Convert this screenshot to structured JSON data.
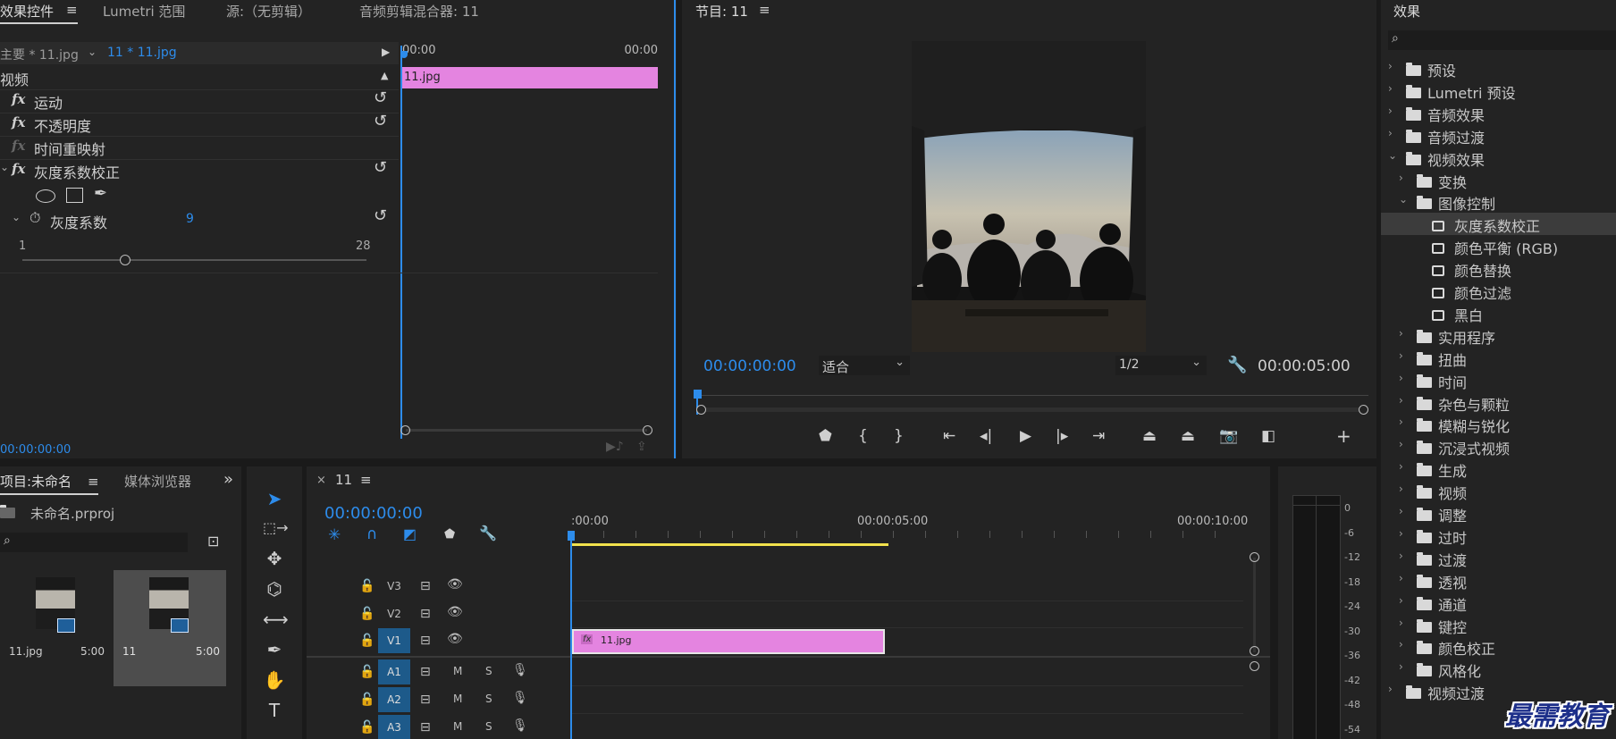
{
  "effect_controls": {
    "tabs": [
      "效果控件",
      "Lumetri 范围",
      "源:（无剪辑）",
      "音频剪辑混合器: 11"
    ],
    "menu_glyph": "≡",
    "master_clip": "主要 * 11.jpg",
    "sequence_clip": "11 * 11.jpg",
    "ruler_start": "00:00",
    "ruler_end": "00:00",
    "clip_name": "11.jpg",
    "section": "视频",
    "effects": [
      {
        "name": "运动"
      },
      {
        "name": "不透明度"
      },
      {
        "name": "时间重映射"
      },
      {
        "name": "灰度系数校正"
      }
    ],
    "param_name": "灰度系数",
    "param_value": "9",
    "slider_min": "1",
    "slider_max": "28",
    "slider_value": 9,
    "timecode": "00:00:00:00"
  },
  "program": {
    "title": "节目: 11",
    "timecode_left": "00:00:00:00",
    "fit": "适合",
    "resolution": "1/2",
    "timecode_right": "00:00:05:00"
  },
  "effects_panel": {
    "title": "效果",
    "items": [
      {
        "label": "预设",
        "icon": "folder-star",
        "indent": 0,
        "open": false
      },
      {
        "label": "Lumetri 预设",
        "icon": "folder-star",
        "indent": 0,
        "open": false
      },
      {
        "label": "音频效果",
        "icon": "folder",
        "indent": 0,
        "open": false
      },
      {
        "label": "音频过渡",
        "icon": "folder",
        "indent": 0,
        "open": false
      },
      {
        "label": "视频效果",
        "icon": "folder",
        "indent": 0,
        "open": true
      },
      {
        "label": "变换",
        "icon": "folder",
        "indent": 1,
        "open": false
      },
      {
        "label": "图像控制",
        "icon": "folder",
        "indent": 1,
        "open": true
      },
      {
        "label": "灰度系数校正",
        "icon": "effect",
        "indent": 2,
        "selected": true
      },
      {
        "label": "颜色平衡 (RGB)",
        "icon": "effect",
        "indent": 2
      },
      {
        "label": "颜色替换",
        "icon": "effect",
        "indent": 2
      },
      {
        "label": "颜色过滤",
        "icon": "effect",
        "indent": 2
      },
      {
        "label": "黑白",
        "icon": "effect",
        "indent": 2
      },
      {
        "label": "实用程序",
        "icon": "folder",
        "indent": 1,
        "open": false
      },
      {
        "label": "扭曲",
        "icon": "folder",
        "indent": 1,
        "open": false
      },
      {
        "label": "时间",
        "icon": "folder",
        "indent": 1,
        "open": false
      },
      {
        "label": "杂色与颗粒",
        "icon": "folder",
        "indent": 1,
        "open": false
      },
      {
        "label": "模糊与锐化",
        "icon": "folder",
        "indent": 1,
        "open": false
      },
      {
        "label": "沉浸式视频",
        "icon": "folder",
        "indent": 1,
        "open": false
      },
      {
        "label": "生成",
        "icon": "folder",
        "indent": 1,
        "open": false
      },
      {
        "label": "视频",
        "icon": "folder",
        "indent": 1,
        "open": false
      },
      {
        "label": "调整",
        "icon": "folder",
        "indent": 1,
        "open": false
      },
      {
        "label": "过时",
        "icon": "folder",
        "indent": 1,
        "open": false
      },
      {
        "label": "过渡",
        "icon": "folder",
        "indent": 1,
        "open": false
      },
      {
        "label": "透视",
        "icon": "folder",
        "indent": 1,
        "open": false
      },
      {
        "label": "通道",
        "icon": "folder",
        "indent": 1,
        "open": false
      },
      {
        "label": "键控",
        "icon": "folder",
        "indent": 1,
        "open": false
      },
      {
        "label": "颜色校正",
        "icon": "folder",
        "indent": 1,
        "open": false
      },
      {
        "label": "风格化",
        "icon": "folder",
        "indent": 1,
        "open": false
      },
      {
        "label": "视频过渡",
        "icon": "folder",
        "indent": 0,
        "open": false
      }
    ]
  },
  "project": {
    "tabs": [
      "项目:未命名",
      "媒体浏览器"
    ],
    "overflow": "»",
    "file": "未命名.prproj",
    "items": [
      {
        "name": "11.jpg",
        "duration": "5:00"
      },
      {
        "name": "11",
        "duration": "5:00"
      }
    ]
  },
  "timeline": {
    "close": "×",
    "title": "11",
    "timecode": "00:00:00:00",
    "ruler": [
      ":00:00",
      "00:00:05:00",
      "00:00:10:00"
    ],
    "video_tracks": [
      "V3",
      "V2",
      "V1"
    ],
    "audio_tracks": [
      "A1",
      "A2",
      "A3"
    ],
    "m_label": "M",
    "s_label": "S",
    "clip_name": "11.jpg"
  },
  "audio_meter": {
    "labels": [
      "0",
      "-6",
      "-12",
      "-18",
      "-24",
      "-30",
      "-36",
      "-42",
      "-48",
      "-54"
    ]
  },
  "watermark": "最需教育",
  "colors": {
    "accent": "#2d8ceb",
    "clip": "#e484e0",
    "work_area": "#f2e14c"
  }
}
